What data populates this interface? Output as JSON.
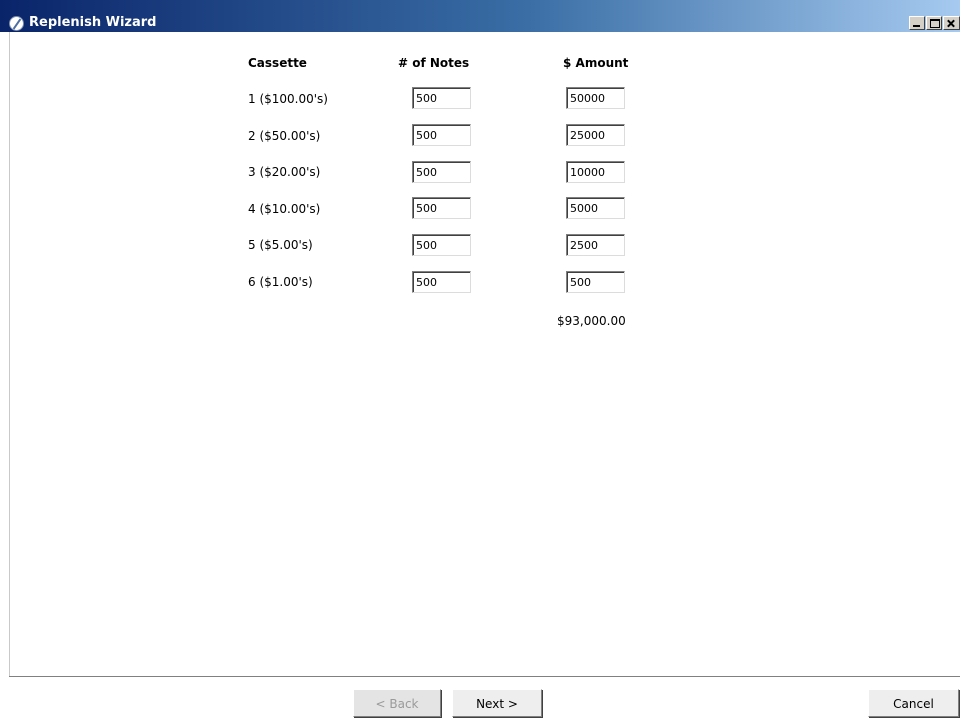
{
  "window": {
    "title": "Replenish Wizard",
    "controls": {
      "minimize": "_",
      "maximize": "□",
      "close": "X"
    }
  },
  "table": {
    "headers": {
      "cassette": "Cassette",
      "notes": "# of Notes",
      "amount": "$ Amount"
    },
    "rows": [
      {
        "cassette": "1 ($100.00's)",
        "notes": "500",
        "amount": "50000"
      },
      {
        "cassette": "2 ($50.00's)",
        "notes": "500",
        "amount": "25000"
      },
      {
        "cassette": "3 ($20.00's)",
        "notes": "500",
        "amount": "10000"
      },
      {
        "cassette": "4 ($10.00's)",
        "notes": "500",
        "amount": "5000"
      },
      {
        "cassette": "5 ($5.00's)",
        "notes": "500",
        "amount": "2500"
      },
      {
        "cassette": "6 ($1.00's)",
        "notes": "500",
        "amount": "500"
      }
    ],
    "total": "$93,000.00"
  },
  "buttons": {
    "back": "< Back",
    "next": "Next >",
    "cancel": "Cancel"
  },
  "colors": {
    "titlebar_start": "#0a246a",
    "titlebar_end": "#a6caf0"
  }
}
